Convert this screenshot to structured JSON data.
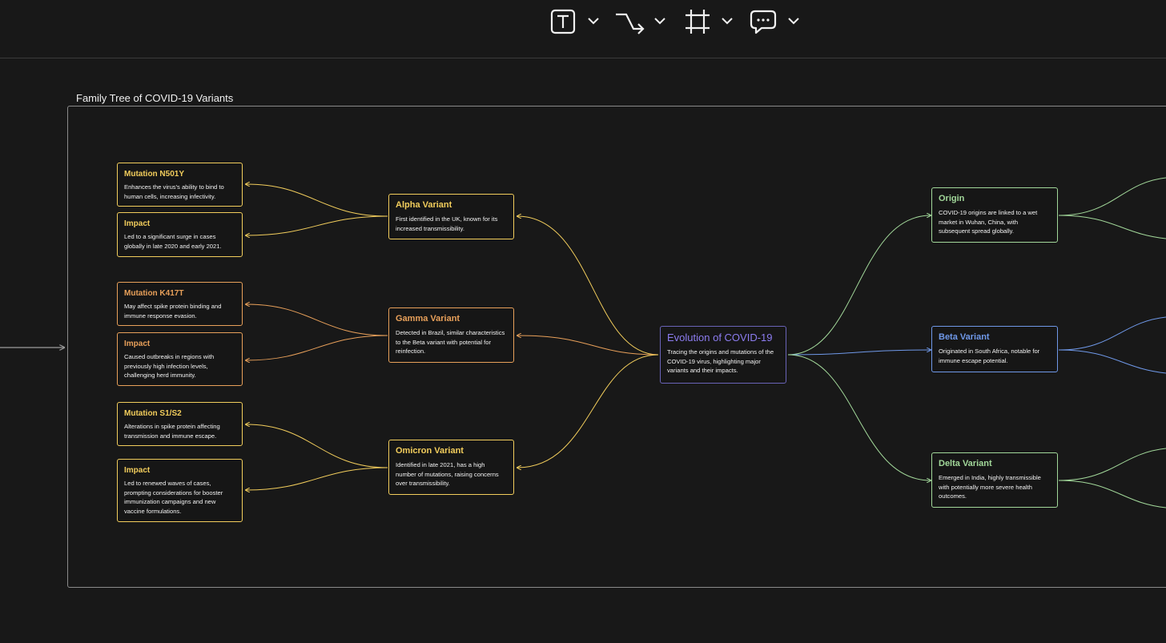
{
  "toolbar": {
    "tools": [
      {
        "name": "text-tool",
        "icon": "text-box-icon"
      },
      {
        "name": "connector-tool",
        "icon": "connector-arrow-icon"
      },
      {
        "name": "frame-tool",
        "icon": "frame-crop-icon"
      },
      {
        "name": "comment-tool",
        "icon": "speech-bubble-icon"
      }
    ]
  },
  "frame": {
    "title": "Family Tree of COVID-19 Variants"
  },
  "colors": {
    "yellow": "#f2cd5c",
    "orange": "#e8a05a",
    "purple": "#8c7cf0",
    "green": "#a2d89a",
    "blue": "#6f98e8",
    "background": "#181818"
  },
  "nodes": {
    "root": {
      "title": "Evolution of COVID-19",
      "desc": "Tracing the origins and mutations of the COVID-19 virus, highlighting major variants and their impacts."
    },
    "alpha": {
      "title": "Alpha Variant",
      "desc": "First identified in the UK, known for its increased transmissibility."
    },
    "gamma": {
      "title": "Gamma Variant",
      "desc": "Detected in Brazil, similar characteristics to the Beta variant with potential for reinfection."
    },
    "omicron": {
      "title": "Omicron Variant",
      "desc": "Identified in late 2021, has a high number of mutations, raising concerns over transmissibility."
    },
    "n501y": {
      "title": "Mutation N501Y",
      "desc": "Enhances the virus's ability to bind to human cells, increasing infectivity."
    },
    "alpha_impact": {
      "title": "Impact",
      "desc": "Led to a significant surge in cases globally in late 2020 and early 2021."
    },
    "k417t": {
      "title": "Mutation K417T",
      "desc": "May affect spike protein binding and immune response evasion."
    },
    "gamma_impact": {
      "title": "Impact",
      "desc": "Caused outbreaks in regions with previously high infection levels, challenging herd immunity."
    },
    "s1s2": {
      "title": "Mutation S1/S2",
      "desc": "Alterations in spike protein affecting transmission and immune escape."
    },
    "omicron_impact": {
      "title": "Impact",
      "desc": "Led to renewed waves of cases, prompting considerations for booster immunization campaigns and new vaccine formulations."
    },
    "origin": {
      "title": "Origin",
      "desc": "COVID-19 origins are linked to a wet market in Wuhan, China, with subsequent spread globally."
    },
    "beta": {
      "title": "Beta Variant",
      "desc": "Originated in South Africa, notable for immune escape potential."
    },
    "delta": {
      "title": "Delta Variant",
      "desc": "Emerged in India, highly transmissible with potentially more severe health outcomes."
    }
  }
}
